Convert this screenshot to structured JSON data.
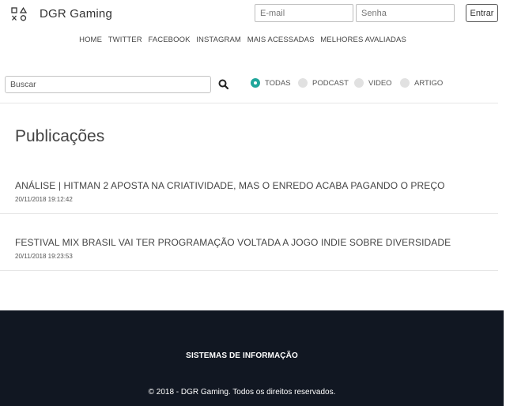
{
  "header": {
    "brand": "DGR Gaming",
    "logo_icon": "playstation-buttons-icon",
    "email_placeholder": "E-mail",
    "senha_placeholder": "Senha",
    "login_button": "Entrar"
  },
  "nav": {
    "items": [
      "HOME",
      "TWITTER",
      "FACEBOOK",
      "INSTAGRAM",
      "MAIS ACESSADAS",
      "MELHORES AVALIADAS"
    ]
  },
  "search": {
    "placeholder": "Buscar",
    "icon": "search-icon"
  },
  "filters": {
    "options": [
      "TODAS",
      "PODCAST",
      "VIDEO",
      "ARTIGO"
    ],
    "selected": "TODAS",
    "accent_color": "#20a69b"
  },
  "main": {
    "title": "Publicações",
    "posts": [
      {
        "title": "ANÁLISE | HITMAN 2 APOSTA NA CRIATIVIDADE, MAS O ENREDO ACABA PAGANDO O PREÇO",
        "date": "20/11/2018 19:12:42"
      },
      {
        "title": "FESTIVAL MIX BRASIL VAI TER PROGRAMAÇÃO VOLTADA A JOGO INDIE SOBRE DIVERSIDADE",
        "date": "20/11/2018 19:23:53"
      }
    ]
  },
  "footer": {
    "title": "SISTEMAS DE INFORMAÇÃO",
    "copyright": "© 2018 - DGR Gaming. Todos os direitos reservados.",
    "background_color": "#111722"
  }
}
